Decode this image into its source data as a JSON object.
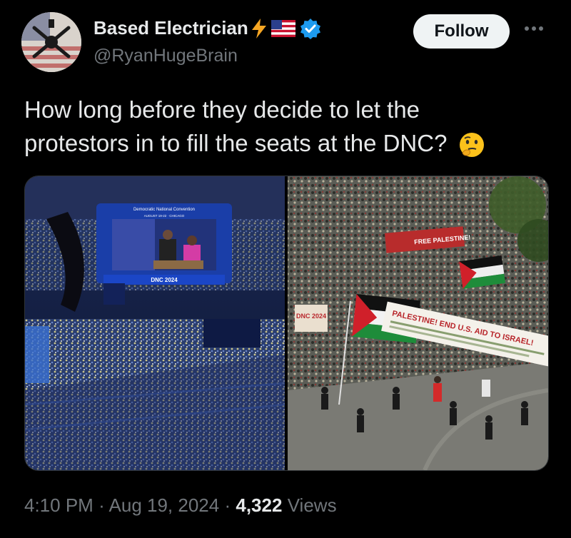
{
  "author": {
    "name": "Based Electrician",
    "handle": "@RyanHugeBrain",
    "verified": true,
    "emoji": [
      "lightning",
      "us-flag"
    ]
  },
  "actions": {
    "follow_label": "Follow"
  },
  "tweet": {
    "text": "How long before they decide to let the protestors in to fill the seats at the DNC?",
    "emoji": "thinking-face"
  },
  "media": {
    "left": {
      "screen_title": "Democratic National Convention",
      "screen_date": "AUGUST 19-22 · CHICAGO",
      "ribbon": "DNC 2024",
      "side_label": "DNC 2024"
    },
    "right": {
      "banner_top": "FREE PALESTINE!",
      "banner_main": "PALESTINE! END U.S. AID TO ISRAEL!",
      "sign": "DNC 2024"
    }
  },
  "meta": {
    "time": "4:10 PM",
    "date": "Aug 19, 2024",
    "sep": "·",
    "views_count": "4,322",
    "views_label": "Views"
  },
  "colors": {
    "background": "#000000",
    "text": "#e7e9ea",
    "secondary": "#71767b",
    "verified": "#1d9bf0",
    "follow_bg": "#eff3f4"
  }
}
